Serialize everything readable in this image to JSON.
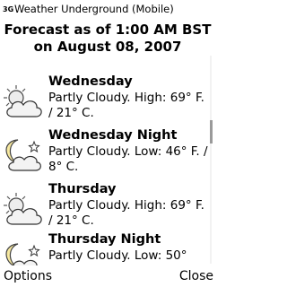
{
  "status": {
    "network": "3G"
  },
  "app": {
    "title": "Weather Underground (Mobile)"
  },
  "forecast": {
    "heading_line1": "Forecast as of 1:00 AM BST",
    "heading_line2": "on August 08, 2007",
    "items": [
      {
        "day": "Wednesday",
        "description": "Partly Cloudy. High: 69° F. / 21° C.",
        "icon": "partly-cloudy-day-icon"
      },
      {
        "day": "Wednesday Night",
        "description": "Partly Cloudy. Low: 46° F. / 8° C.",
        "icon": "partly-cloudy-night-icon"
      },
      {
        "day": "Thursday",
        "description": "Partly Cloudy. High: 69° F. / 21° C.",
        "icon": "partly-cloudy-day-icon"
      },
      {
        "day": "Thursday Night",
        "description": "Partly Cloudy. Low: 50°",
        "icon": "partly-cloudy-night-icon"
      }
    ]
  },
  "softkeys": {
    "left": "Options",
    "right": "Close"
  }
}
